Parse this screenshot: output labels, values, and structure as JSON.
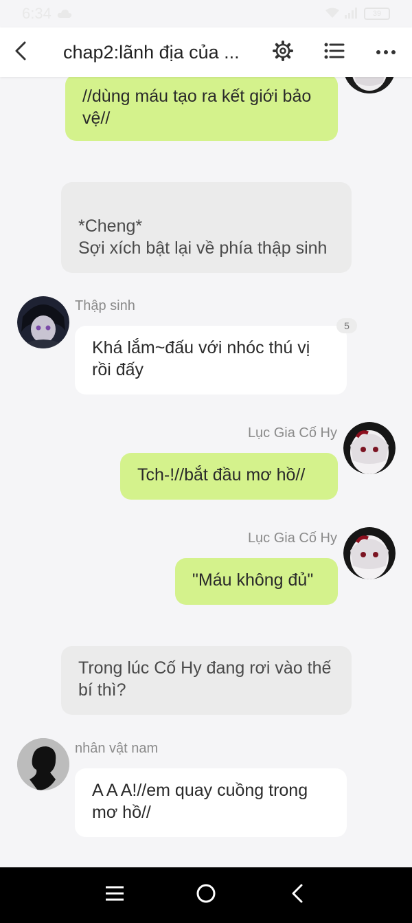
{
  "status": {
    "time": "6:34",
    "battery": "39"
  },
  "header": {
    "title": "chap2:lãnh địa của ..."
  },
  "messages": [
    {
      "text": "//dùng máu tạo ra kết giới bảo vệ//"
    },
    {
      "text": "*Cheng*\nSợi xích bật lại về phía thập sinh"
    },
    {
      "sender": "Thập sinh",
      "text": "Khá lắm~đấu với nhóc thú vị rồi đấy",
      "badge": "5"
    },
    {
      "sender": "Lục Gia Cố Hy",
      "text": "Tch-!//bắt đầu mơ hồ//"
    },
    {
      "sender": "Lục Gia Cố Hy",
      "text": "\"Máu không đủ\""
    },
    {
      "text": "Trong lúc Cố Hy đang rơi vào thế bí thì?"
    },
    {
      "sender": "nhân vật nam",
      "text": "A A A!//em quay cuồng trong mơ hồ//"
    }
  ],
  "colors": {
    "right_bubble": "#d4f28c",
    "left_bubble": "#ffffff",
    "narration_bubble": "#ebebeb",
    "background": "#f5f5f7"
  },
  "icons": [
    "back-icon",
    "gear-icon",
    "list-icon",
    "more-icon",
    "menu-icon",
    "home-icon",
    "nav-back-icon"
  ]
}
